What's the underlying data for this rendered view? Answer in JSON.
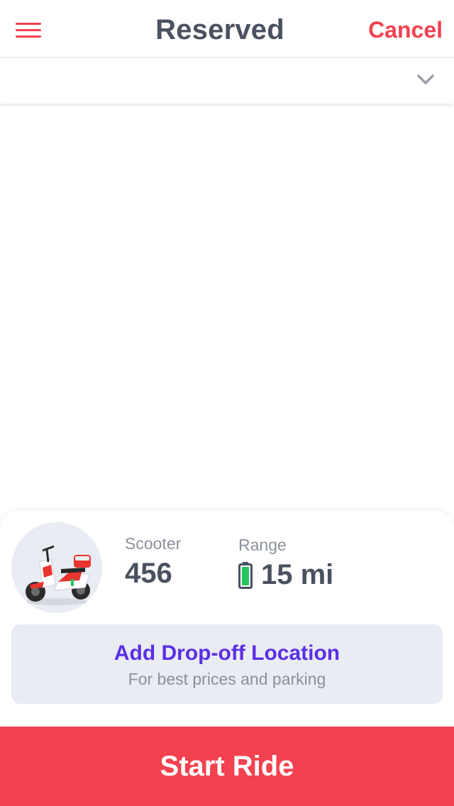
{
  "header": {
    "title": "Reserved",
    "cancel_label": "Cancel",
    "menu_icon": "hamburger-menu-icon",
    "accent_color": "#f2414f"
  },
  "subbar": {
    "chevron_icon": "chevron-down-icon"
  },
  "vehicle": {
    "image": "scooter-image",
    "type_label": "Scooter",
    "number": "456",
    "range_label": "Range",
    "range_value": "15 mi",
    "battery_icon": "battery-icon",
    "battery_color": "#22c55e"
  },
  "dropoff": {
    "title": "Add Drop-off Location",
    "subtitle": "For best prices and parking",
    "title_color": "#5b2ee6"
  },
  "actions": {
    "start_label": "Start Ride"
  }
}
